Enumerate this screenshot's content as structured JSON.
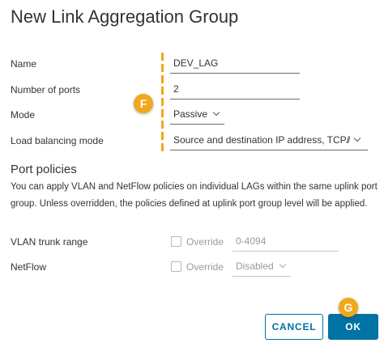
{
  "dialog": {
    "title": "New Link Aggregation Group"
  },
  "form": {
    "name": {
      "label": "Name",
      "value": "DEV_LAG"
    },
    "ports": {
      "label": "Number of ports",
      "value": "2"
    },
    "mode": {
      "label": "Mode",
      "value": "Passive"
    },
    "load_balancing": {
      "label": "Load balancing mode",
      "value": "Source and destination IP address, TCP/̸"
    }
  },
  "policies": {
    "heading": "Port policies",
    "description": "You can apply VLAN and NetFlow policies on individual LAGs within the same uplink port group. Unless overridden, the policies defined at uplink port group level will be applied.",
    "vlan": {
      "label": "VLAN trunk range",
      "override_label": "Override",
      "value": "0-4094"
    },
    "netflow": {
      "label": "NetFlow",
      "override_label": "Override",
      "value": "Disabled"
    }
  },
  "callouts": {
    "f": "F",
    "g": "G"
  },
  "buttons": {
    "cancel": "CANCEL",
    "ok": "OK"
  },
  "colors": {
    "accent": "#0072a3",
    "callout": "#f0a81c"
  }
}
